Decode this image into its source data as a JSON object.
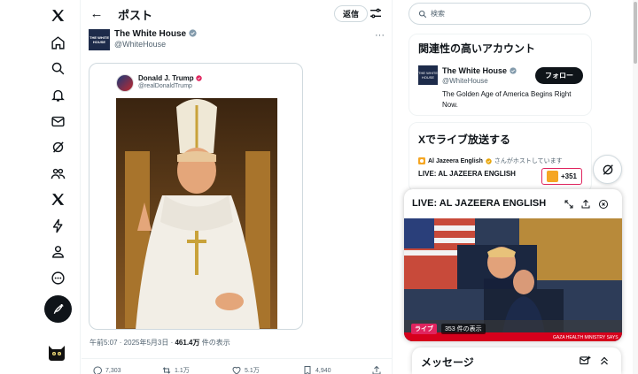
{
  "nav": {
    "items": [
      "x-logo-icon",
      "home-icon",
      "explore-icon",
      "notifications-icon",
      "messages-icon",
      "grok-icon",
      "communities-icon",
      "premium-icon",
      "verified-orgs-icon",
      "profile-icon",
      "more-icon"
    ]
  },
  "header": {
    "title": "ポスト",
    "reply_label": "返信"
  },
  "post": {
    "author_name": "The White House",
    "author_handle": "@WhiteHouse",
    "avatar_text": "THE WHITE HOUSE",
    "quoted_name": "Donald J. Trump",
    "quoted_handle": "@realDonaldTrump",
    "meta_prefix": "午前5:07 · 2025年5月3日 · ",
    "views_count": "461.4万",
    "views_suffix": " 件の表示",
    "replies": "7,303",
    "reposts": "1.1万",
    "likes": "5.1万",
    "bookmarks": "4,940"
  },
  "search": {
    "placeholder": "検索"
  },
  "related": {
    "title": "関連性の高いアカウント",
    "name": "The White House",
    "handle": "@WhiteHouse",
    "follow_label": "フォロー",
    "bio": "The Golden Age of America Begins Right Now."
  },
  "live": {
    "section_title": "Xでライブ放送する",
    "host_name": "Al Jazeera English",
    "host_suffix": "さんがホストしています",
    "broadcast_title": "LIVE: AL JAZEERA ENGLISH",
    "listener_count": "+351"
  },
  "popup": {
    "title": "LIVE: AL JAZEERA ENGLISH",
    "live_label": "ライブ",
    "views_label": "353 件の表示",
    "ticker": "GAZA HEALTH MINISTRY SAYS"
  },
  "messages": {
    "title": "メッセージ"
  },
  "colors": {
    "verified_blue": "#1d9bf0",
    "accent_black": "#0f1419",
    "live_red": "#e0245e",
    "gold": "#f5a623"
  }
}
